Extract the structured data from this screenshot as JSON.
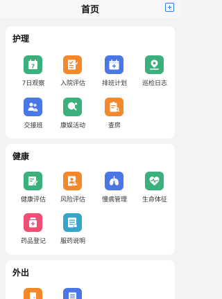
{
  "header": {
    "title": "首页",
    "add_icon": "plus-square-icon",
    "accent": "#2f7de1"
  },
  "sections": {
    "nursing": {
      "title": "护理",
      "items": [
        {
          "label": "7日观察",
          "icon": "calendar-7-icon",
          "color": "#3bb07c"
        },
        {
          "label": "入院评估",
          "icon": "checklist-icon",
          "color": "#f3892b"
        },
        {
          "label": "排班计划",
          "icon": "schedule-icon",
          "color": "#4a76e6"
        },
        {
          "label": "巡检日志",
          "icon": "location-pin-icon",
          "color": "#3bb07c"
        },
        {
          "label": "交接班",
          "icon": "handover-icon",
          "color": "#4a76e6"
        },
        {
          "label": "康娱活动",
          "icon": "ping-pong-icon",
          "color": "#3bb07c"
        },
        {
          "label": "查房",
          "icon": "ward-round-icon",
          "color": "#f3892b"
        }
      ]
    },
    "health": {
      "title": "健康",
      "items": [
        {
          "label": "健康评估",
          "icon": "edit-document-icon",
          "color": "#3bb07c"
        },
        {
          "label": "风险评估",
          "icon": "risk-report-icon",
          "color": "#f3892b"
        },
        {
          "label": "慢病管理",
          "icon": "lungs-icon",
          "color": "#4a76e6"
        },
        {
          "label": "生命体征",
          "icon": "heartbeat-icon",
          "color": "#3bb07c"
        },
        {
          "label": "药品登记",
          "icon": "medicine-bottle-icon",
          "color": "#ee4f73"
        },
        {
          "label": "服药说明",
          "icon": "instruction-icon",
          "color": "#35a6c8"
        }
      ]
    },
    "outing": {
      "title": "外出",
      "items": [
        {
          "label": "",
          "icon": "door-exit-icon",
          "color": "#f3892b"
        },
        {
          "label": "",
          "icon": "list-document-icon",
          "color": "#4a76e6"
        }
      ]
    }
  }
}
